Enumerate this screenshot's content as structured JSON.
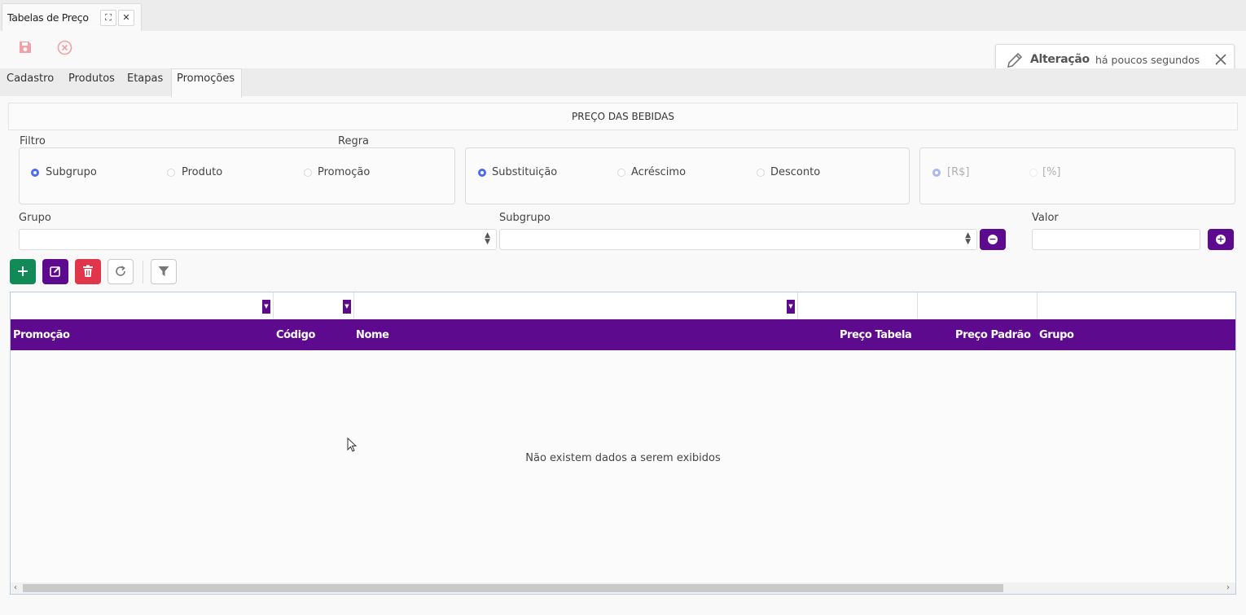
{
  "window": {
    "title": "Tabelas de Preço",
    "maximize_icon": "⛶",
    "close_icon": "✕"
  },
  "notification": {
    "label": "Alteração",
    "time": "há poucos segundos"
  },
  "tabs": [
    {
      "label": "Cadastro"
    },
    {
      "label": "Produtos"
    },
    {
      "label": "Etapas"
    },
    {
      "label": "Promoções",
      "active": true
    }
  ],
  "section_title": "PREÇO DAS BEBIDAS",
  "filtro": {
    "label": "Filtro",
    "options": [
      "Subgrupo",
      "Produto",
      "Promoção"
    ],
    "selected": "Subgrupo"
  },
  "regra": {
    "label": "Regra",
    "options": [
      "Substituição",
      "Acréscimo",
      "Desconto"
    ],
    "selected": "Substituição"
  },
  "unidade": {
    "options": [
      "[R$]",
      "[%]"
    ],
    "selected": "[R$]"
  },
  "fields": {
    "grupo_label": "Grupo",
    "subgrupo_label": "Subgrupo",
    "valor_label": "Valor"
  },
  "grid": {
    "columns": [
      "Promoção",
      "Código",
      "Nome",
      "Preço Tabela",
      "Preço Padrão",
      "Grupo"
    ],
    "empty_message": "Não existem dados a serem exibidos"
  },
  "colors": {
    "accent": "#5e0a8e",
    "add": "#128a58",
    "delete": "#e0354b",
    "radio": "#4a6cf0"
  }
}
